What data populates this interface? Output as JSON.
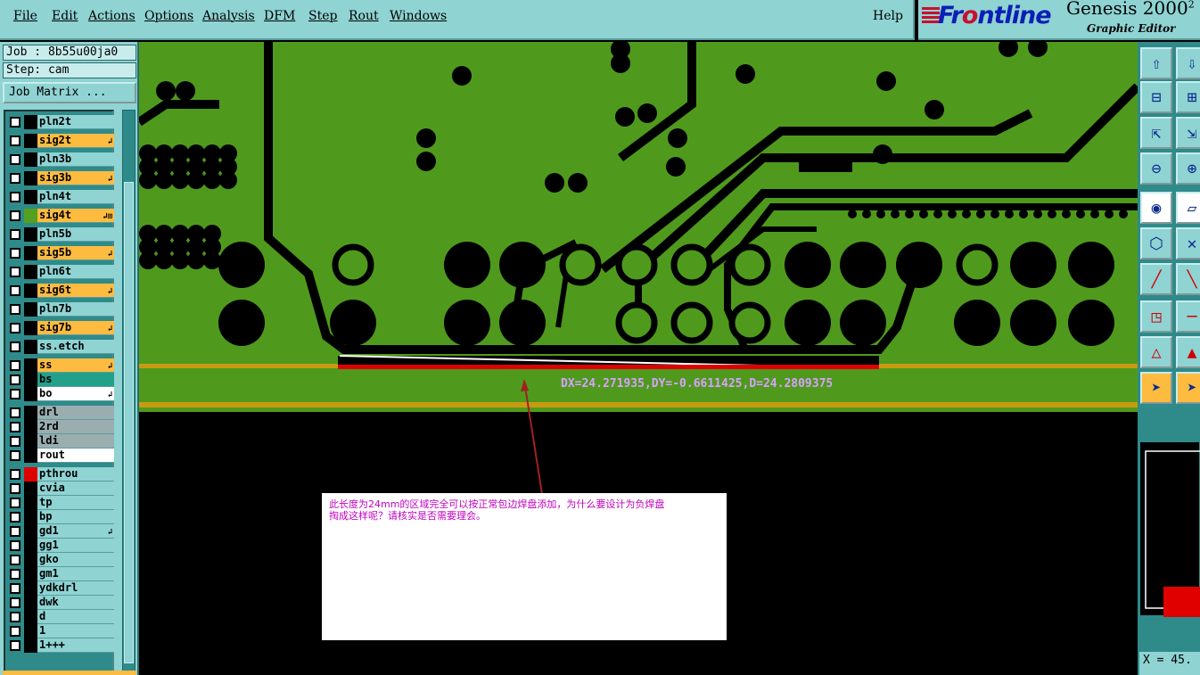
{
  "menu": {
    "items": [
      "File",
      "Edit",
      "Actions",
      "Options",
      "Analysis",
      "DFM",
      "Step",
      "Rout",
      "Windows"
    ],
    "help": "Help"
  },
  "brand": {
    "logo_pre": "Fr",
    "logo_o": "o",
    "logo_post": "ntline",
    "product": "Genesis 2000",
    "superscript": "2",
    "subtitle": "Graphic Editor"
  },
  "job": {
    "job_label": "Job : 8b55u00ja0",
    "step_label": "Step: cam",
    "matrix_button": "Job Matrix ..."
  },
  "layers": [
    {
      "name": "pln2t",
      "style": "plain",
      "flag": "",
      "swatch": "#000000"
    },
    {
      "name": "sig2t",
      "style": "orange",
      "flag": "↲",
      "swatch": "#000000"
    },
    {
      "name": "pln3b",
      "style": "plain",
      "flag": "",
      "swatch": "#000000"
    },
    {
      "name": "sig3b",
      "style": "orange",
      "flag": "↲",
      "swatch": "#000000"
    },
    {
      "name": "pln4t",
      "style": "plain",
      "flag": "",
      "swatch": "#000000"
    },
    {
      "name": "sig4t",
      "style": "orange",
      "flag": "↲⊞",
      "swatch": "#55a020"
    },
    {
      "name": "pln5b",
      "style": "plain",
      "flag": "",
      "swatch": "#000000"
    },
    {
      "name": "sig5b",
      "style": "orange",
      "flag": "↲",
      "swatch": "#000000"
    },
    {
      "name": "pln6t",
      "style": "plain",
      "flag": "",
      "swatch": "#000000"
    },
    {
      "name": "sig6t",
      "style": "orange",
      "flag": "↲",
      "swatch": "#000000"
    },
    {
      "name": "pln7b",
      "style": "plain",
      "flag": "",
      "swatch": "#000000"
    },
    {
      "name": "sig7b",
      "style": "orange",
      "flag": "↲",
      "swatch": "#000000"
    },
    {
      "name": "ss.etch",
      "style": "plain",
      "flag": "",
      "swatch": "#000000"
    },
    {
      "name": "ss",
      "style": "orange",
      "flag": "↲",
      "swatch": "#000000"
    },
    {
      "name": "bs",
      "style": "teal",
      "flag": "",
      "swatch": "#000000"
    },
    {
      "name": "bo",
      "style": "white",
      "flag": "↲",
      "swatch": "#000000"
    },
    {
      "name": "drl",
      "style": "grey",
      "flag": "",
      "swatch": "#000000"
    },
    {
      "name": "2rd",
      "style": "grey",
      "flag": "",
      "swatch": "#000000"
    },
    {
      "name": "ldi",
      "style": "grey",
      "flag": "",
      "swatch": "#000000"
    },
    {
      "name": "rout",
      "style": "white",
      "flag": "",
      "swatch": "#000000"
    },
    {
      "name": "pthrou",
      "style": "plain",
      "flag": "",
      "swatch": "#e00000"
    },
    {
      "name": "cvia",
      "style": "plain",
      "flag": "",
      "swatch": "#000000"
    },
    {
      "name": "tp",
      "style": "plain",
      "flag": "",
      "swatch": "#000000"
    },
    {
      "name": "bp",
      "style": "plain",
      "flag": "",
      "swatch": "#000000"
    },
    {
      "name": "gd1",
      "style": "plain",
      "flag": "↲",
      "swatch": "#000000"
    },
    {
      "name": "gg1",
      "style": "plain",
      "flag": "",
      "swatch": "#000000"
    },
    {
      "name": "gko",
      "style": "plain",
      "flag": "",
      "swatch": "#000000"
    },
    {
      "name": "gm1",
      "style": "plain",
      "flag": "",
      "swatch": "#000000"
    },
    {
      "name": "ydkdrl",
      "style": "plain",
      "flag": "",
      "swatch": "#000000"
    },
    {
      "name": "dwk",
      "style": "plain",
      "flag": "",
      "swatch": "#000000"
    },
    {
      "name": "d",
      "style": "plain",
      "flag": "",
      "swatch": "#000000"
    },
    {
      "name": "1",
      "style": "plain",
      "flag": "",
      "swatch": "#000000"
    },
    {
      "name": "1+++",
      "style": "plain",
      "flag": "",
      "swatch": "#000000"
    }
  ],
  "canvas": {
    "measurement": "DX=24.271935,DY=-0.6611425,D=24.2809375",
    "board_color": "#4f9a1c",
    "outline_color": "#c89a10"
  },
  "comment": {
    "line1": "此长度为24mm的区域完全可以按正常包边焊盘添加，为什么要设计为负焊盘",
    "line2": "掏成这样呢？请核实是否需要理会。"
  },
  "tools": {
    "icons": [
      "layer-up-icon",
      "layer-down-icon",
      "zoom-in-icon",
      "zoom-out-icon",
      "fit-icon",
      "pan-icon",
      "measure-icon",
      "grid-icon",
      "snap-icon",
      "area-icon",
      "net-icon",
      "cross-icon",
      "line-icon",
      "slant-icon",
      "select-icon",
      "wire-icon",
      "triangle-icon",
      "triangle2-icon",
      "pointer-icon",
      "pointer2-icon"
    ],
    "coord": "X = 45."
  }
}
